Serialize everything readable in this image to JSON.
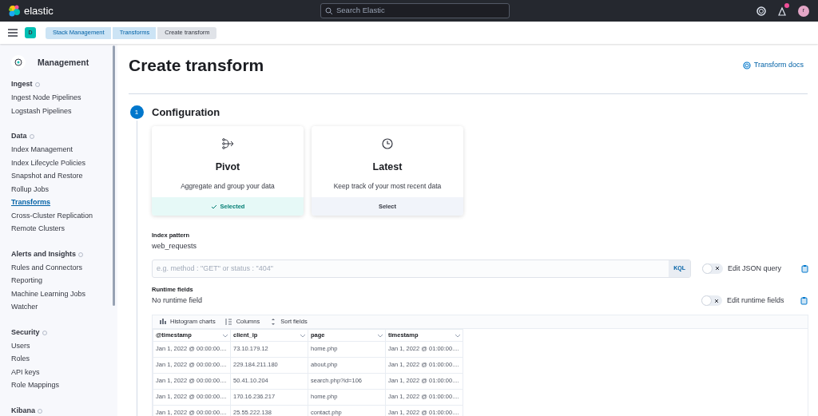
{
  "header": {
    "brand": "elastic",
    "search_placeholder": "Search Elastic",
    "avatar": "r",
    "has_news": true
  },
  "breadcrumbs": {
    "space": "D",
    "items": [
      {
        "label": "Stack Management",
        "current": false
      },
      {
        "label": "Transforms",
        "current": false
      },
      {
        "label": "Create transform",
        "current": true
      }
    ]
  },
  "sidebar": {
    "title": "Management",
    "sections": [
      {
        "title": "Ingest",
        "items": [
          {
            "label": "Ingest Node Pipelines",
            "selected": false
          },
          {
            "label": "Logstash Pipelines",
            "selected": false
          }
        ]
      },
      {
        "title": "Data",
        "items": [
          {
            "label": "Index Management",
            "selected": false
          },
          {
            "label": "Index Lifecycle Policies",
            "selected": false
          },
          {
            "label": "Snapshot and Restore",
            "selected": false
          },
          {
            "label": "Rollup Jobs",
            "selected": false
          },
          {
            "label": "Transforms",
            "selected": true
          },
          {
            "label": "Cross-Cluster Replication",
            "selected": false
          },
          {
            "label": "Remote Clusters",
            "selected": false
          }
        ]
      },
      {
        "title": "Alerts and Insights",
        "items": [
          {
            "label": "Rules and Connectors",
            "selected": false
          },
          {
            "label": "Reporting",
            "selected": false
          },
          {
            "label": "Machine Learning Jobs",
            "selected": false
          },
          {
            "label": "Watcher",
            "selected": false
          }
        ]
      },
      {
        "title": "Security",
        "items": [
          {
            "label": "Users",
            "selected": false
          },
          {
            "label": "Roles",
            "selected": false
          },
          {
            "label": "API keys",
            "selected": false
          },
          {
            "label": "Role Mappings",
            "selected": false
          }
        ]
      },
      {
        "title": "Kibana"
      }
    ]
  },
  "page": {
    "title": "Create transform",
    "docs_link": "Transform docs"
  },
  "step": {
    "number": "1",
    "title": "Configuration"
  },
  "cards": [
    {
      "kind": "pivot",
      "title": "Pivot",
      "description": "Aggregate and group your data",
      "button": "Selected",
      "selected": true
    },
    {
      "kind": "latest",
      "title": "Latest",
      "description": "Keep track of your most recent data",
      "button": "Select",
      "selected": false
    }
  ],
  "index_pattern": {
    "label": "Index pattern",
    "value": "web_requests"
  },
  "query": {
    "placeholder": "e.g. method : \"GET\" or status : \"404\"",
    "language": "KQL"
  },
  "json_toggle": {
    "label": "Edit JSON query",
    "on": false
  },
  "runtime": {
    "label": "Runtime fields",
    "value": "No runtime field"
  },
  "runtime_toggle": {
    "label": "Edit runtime fields",
    "on": false
  },
  "grid": {
    "toolbar": [
      "Histogram charts",
      "Columns",
      "Sort fields"
    ],
    "columns": [
      "@timestamp",
      "client_ip",
      "page",
      "timestamp"
    ],
    "rows": [
      [
        "Jan 1, 2022 @ 00:00:00....",
        "73.10.179.12",
        "home.php",
        "Jan 1, 2022 @ 01:00:00...."
      ],
      [
        "Jan 1, 2022 @ 00:00:00....",
        "229.184.211.180",
        "about.php",
        "Jan 1, 2022 @ 01:00:00...."
      ],
      [
        "Jan 1, 2022 @ 00:00:00....",
        "50.41.10.204",
        "search.php?id=106",
        "Jan 1, 2022 @ 01:00:00...."
      ],
      [
        "Jan 1, 2022 @ 00:00:00....",
        "170.16.236.217",
        "home.php",
        "Jan 1, 2022 @ 01:00:00...."
      ],
      [
        "Jan 1, 2022 @ 00:00:00....",
        "25.55.222.138",
        "contact.php",
        "Jan 1, 2022 @ 01:00:00...."
      ]
    ]
  }
}
